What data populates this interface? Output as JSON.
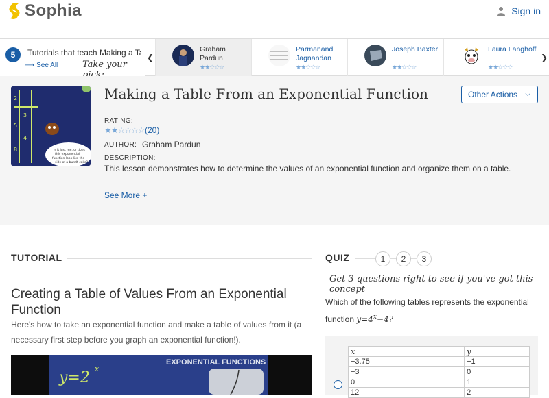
{
  "header": {
    "logo_text": "Sophia",
    "signin_label": "Sign in",
    "brand_color": "#f2c200",
    "link_color": "#1a5ea6"
  },
  "strip": {
    "count": "5",
    "title": "Tutorials that teach Making a Ta",
    "see_all": "See All",
    "take_pick": "Take your pick:",
    "cards": [
      {
        "name_line1": "Graham",
        "name_line2": "Pardun",
        "stars": "★★☆☆☆"
      },
      {
        "name_line1": "Parmanand",
        "name_line2": "Jagnandan",
        "stars": "★★☆☆☆"
      },
      {
        "name_line1": "Joseph Baxter",
        "name_line2": "",
        "stars": "★★☆☆☆"
      },
      {
        "name_line1": "Laura Langhoff",
        "name_line2": "",
        "stars": "★★☆☆☆"
      }
    ]
  },
  "lesson": {
    "title": "Making a Table From an Exponential Function",
    "other_actions": "Other Actions",
    "rating_label": "RATING:",
    "rating_stars": "★★☆☆☆☆",
    "rating_count": "(20)",
    "author_label": "AUTHOR:",
    "author_name": "Graham Pardun",
    "description_label": "DESCRIPTION:",
    "description": "This lesson demonstrates how to determine the values of an exponential function and organize them on a table.",
    "see_more": "See More +",
    "thumb_caption": "Is it just me, or does this exponential function look like the side of a bundt cake?"
  },
  "tutorial": {
    "heading": "TUTORIAL",
    "title": "Creating a Table of Values From an Exponential Function",
    "description": "Here's how to take an exponential function and make a table of values from it (a necessary first step before you graph an exponential function!).",
    "video_label": "EXPONENTIAL FUNCTIONS",
    "video_equation": "y=2"
  },
  "quiz": {
    "heading": "QUIZ",
    "numbers": [
      "1",
      "2",
      "3"
    ],
    "hint": "Get 3 questions right to see if you've got this concept",
    "question_prefix": "Which of the following tables represents the exponential function",
    "question_equation": "y=4",
    "question_exponent": "x",
    "question_suffix": "−4?",
    "table_headers": [
      "x",
      "y"
    ],
    "table_rows": [
      [
        "−3.75",
        "−1"
      ],
      [
        "−3",
        "0"
      ],
      [
        "0",
        "1"
      ],
      [
        "12",
        "2"
      ]
    ]
  }
}
